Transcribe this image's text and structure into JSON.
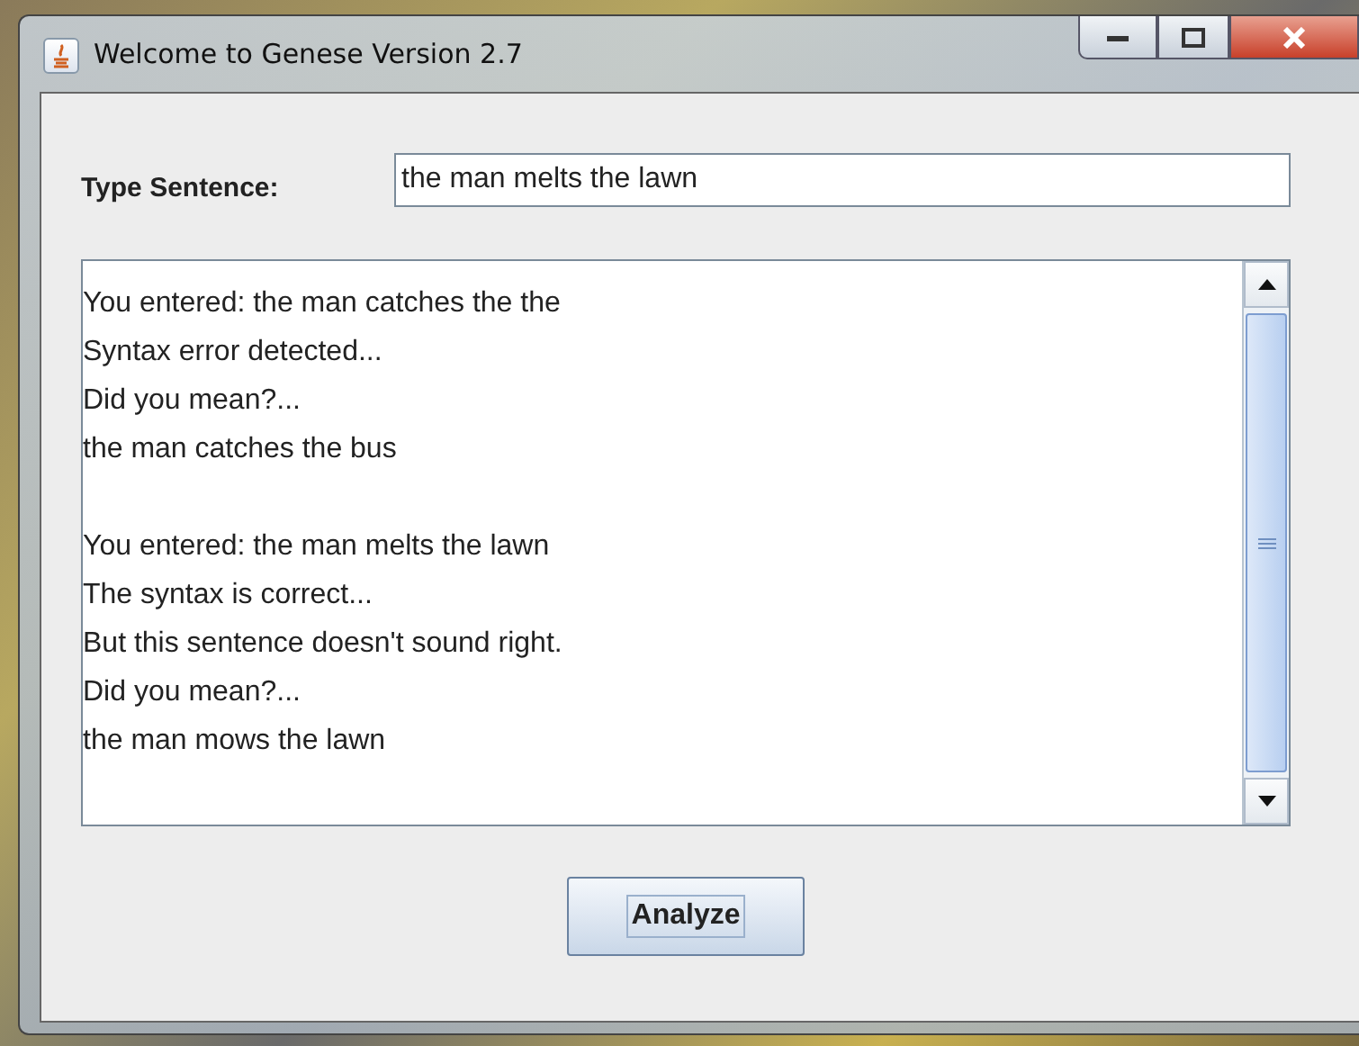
{
  "window": {
    "title": "Welcome to Genese Version 2.7"
  },
  "sentence_field": {
    "label": "Type Sentence:",
    "value": "the man melts the lawn"
  },
  "output": {
    "blocks": [
      {
        "lines": [
          "You entered: the man catches the the",
          "Syntax error detected...",
          "Did you mean?...",
          "the man catches the bus"
        ]
      },
      {
        "lines": [
          "You entered: the man melts the lawn",
          "The syntax is correct...",
          "But this sentence doesn't sound right.",
          "Did you mean?...",
          "the man mows the lawn"
        ]
      }
    ]
  },
  "buttons": [
    {
      "label": "Analyze",
      "focused": true
    }
  ]
}
